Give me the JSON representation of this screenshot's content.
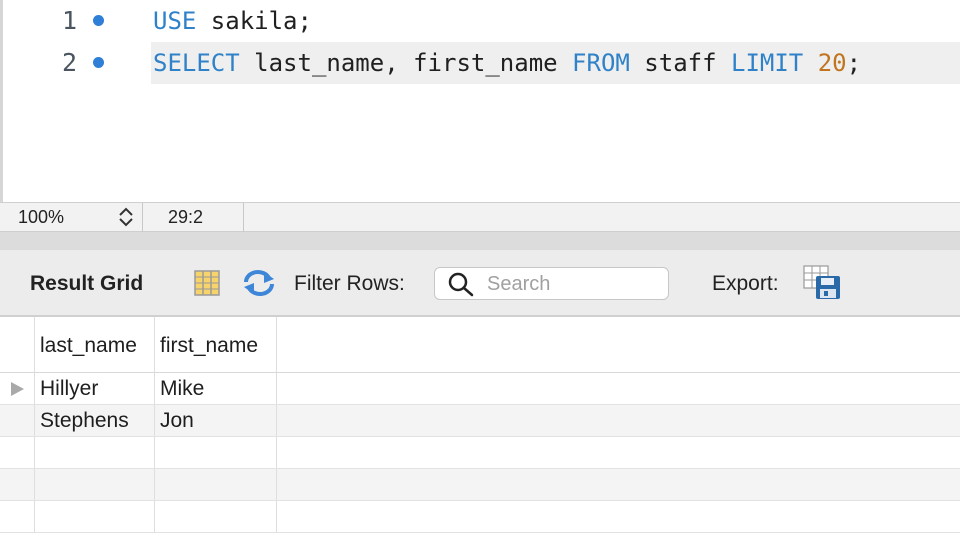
{
  "editor": {
    "lines": [
      {
        "number": "1",
        "tokens": [
          {
            "text": "USE",
            "kind": "kw"
          },
          {
            "text": " sakila;",
            "kind": "plain"
          }
        ]
      },
      {
        "number": "2",
        "tokens": [
          {
            "text": "SELECT",
            "kind": "kw"
          },
          {
            "text": " last_name, first_name ",
            "kind": "plain"
          },
          {
            "text": "FROM",
            "kind": "kw"
          },
          {
            "text": " staff ",
            "kind": "plain"
          },
          {
            "text": "LIMIT",
            "kind": "kw"
          },
          {
            "text": " ",
            "kind": "plain"
          },
          {
            "text": "20",
            "kind": "num"
          },
          {
            "text": ";",
            "kind": "plain"
          }
        ]
      }
    ],
    "colors": {
      "keyword": "#2f82c8",
      "number": "#c1751f",
      "statement_dot": "#2f7fd6"
    }
  },
  "statusbar": {
    "zoom": "100%",
    "cursor_position": "29:2"
  },
  "result_toolbar": {
    "title": "Result Grid",
    "filter_label": "Filter Rows:",
    "search_placeholder": "Search",
    "search_value": "",
    "export_label": "Export:",
    "icons": [
      "grid-layout-icon",
      "refresh-icon",
      "search-icon",
      "export-icon"
    ]
  },
  "grid": {
    "columns": [
      "last_name",
      "first_name"
    ],
    "rows": [
      [
        "Hillyer",
        "Mike"
      ],
      [
        "Stephens",
        "Jon"
      ]
    ],
    "selected_row": 0
  }
}
